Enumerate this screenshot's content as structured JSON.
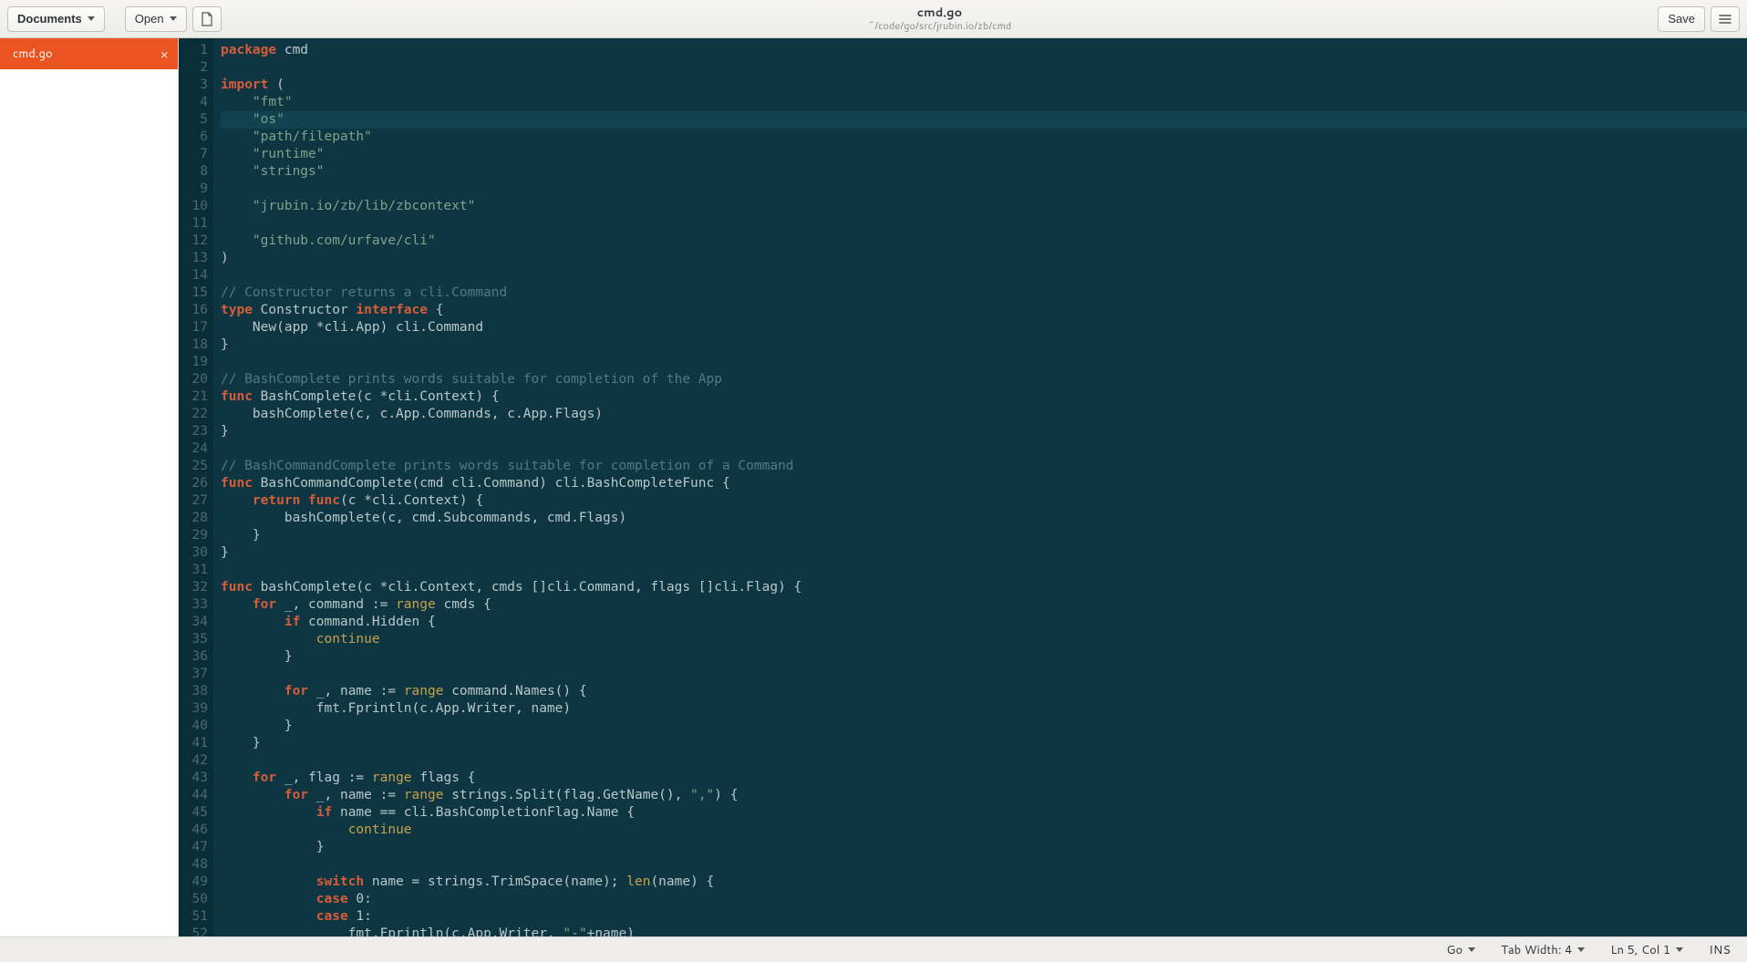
{
  "header": {
    "documents_label": "Documents",
    "open_label": "Open",
    "save_label": "Save",
    "title": "cmd.go",
    "subtitle": "~/code/go/src/jrubin.io/zb/cmd"
  },
  "sidebar": {
    "tabs": [
      {
        "label": "cmd.go",
        "active": true
      }
    ]
  },
  "editor": {
    "current_line_index": 4,
    "lines": [
      [
        [
          "kw",
          "package"
        ],
        [
          "plain",
          " cmd"
        ]
      ],
      [],
      [
        [
          "kw",
          "import"
        ],
        [
          "plain",
          " ("
        ]
      ],
      [
        [
          "plain",
          "    "
        ],
        [
          "str",
          "\"fmt\""
        ]
      ],
      [
        [
          "plain",
          "    "
        ],
        [
          "str",
          "\"os\""
        ]
      ],
      [
        [
          "plain",
          "    "
        ],
        [
          "str",
          "\"path/filepath\""
        ]
      ],
      [
        [
          "plain",
          "    "
        ],
        [
          "str",
          "\"runtime\""
        ]
      ],
      [
        [
          "plain",
          "    "
        ],
        [
          "str",
          "\"strings\""
        ]
      ],
      [],
      [
        [
          "plain",
          "    "
        ],
        [
          "str",
          "\"jrubin.io/zb/lib/zbcontext\""
        ]
      ],
      [],
      [
        [
          "plain",
          "    "
        ],
        [
          "str",
          "\"github.com/urfave/cli\""
        ]
      ],
      [
        [
          "plain",
          ")"
        ]
      ],
      [],
      [
        [
          "comment",
          "// Constructor returns a cli.Command"
        ]
      ],
      [
        [
          "kw",
          "type"
        ],
        [
          "plain",
          " Constructor "
        ],
        [
          "kw",
          "interface"
        ],
        [
          "plain",
          " {"
        ]
      ],
      [
        [
          "plain",
          "    New(app *cli.App) cli.Command"
        ]
      ],
      [
        [
          "plain",
          "}"
        ]
      ],
      [],
      [
        [
          "comment",
          "// BashComplete prints words suitable for completion of the App"
        ]
      ],
      [
        [
          "kw",
          "func"
        ],
        [
          "plain",
          " BashComplete(c *cli.Context) {"
        ]
      ],
      [
        [
          "plain",
          "    bashComplete(c, c.App.Commands, c.App.Flags)"
        ]
      ],
      [
        [
          "plain",
          "}"
        ]
      ],
      [],
      [
        [
          "comment",
          "// BashCommandComplete prints words suitable for completion of a Command"
        ]
      ],
      [
        [
          "kw",
          "func"
        ],
        [
          "plain",
          " BashCommandComplete(cmd cli.Command) cli.BashCompleteFunc {"
        ]
      ],
      [
        [
          "plain",
          "    "
        ],
        [
          "kw",
          "return"
        ],
        [
          "plain",
          " "
        ],
        [
          "kw",
          "func"
        ],
        [
          "plain",
          "(c *cli.Context) {"
        ]
      ],
      [
        [
          "plain",
          "        bashComplete(c, cmd.Subcommands, cmd.Flags)"
        ]
      ],
      [
        [
          "plain",
          "    }"
        ]
      ],
      [
        [
          "plain",
          "}"
        ]
      ],
      [],
      [
        [
          "kw",
          "func"
        ],
        [
          "plain",
          " bashComplete(c *cli.Context, cmds []cli.Command, flags []cli.Flag) {"
        ]
      ],
      [
        [
          "plain",
          "    "
        ],
        [
          "kw",
          "for"
        ],
        [
          "plain",
          " _, command := "
        ],
        [
          "builtin",
          "range"
        ],
        [
          "plain",
          " cmds {"
        ]
      ],
      [
        [
          "plain",
          "        "
        ],
        [
          "kw",
          "if"
        ],
        [
          "plain",
          " command.Hidden {"
        ]
      ],
      [
        [
          "plain",
          "            "
        ],
        [
          "builtin",
          "continue"
        ]
      ],
      [
        [
          "plain",
          "        }"
        ]
      ],
      [],
      [
        [
          "plain",
          "        "
        ],
        [
          "kw",
          "for"
        ],
        [
          "plain",
          " _, name := "
        ],
        [
          "builtin",
          "range"
        ],
        [
          "plain",
          " command.Names() {"
        ]
      ],
      [
        [
          "plain",
          "            fmt.Fprintln(c.App.Writer, name)"
        ]
      ],
      [
        [
          "plain",
          "        }"
        ]
      ],
      [
        [
          "plain",
          "    }"
        ]
      ],
      [],
      [
        [
          "plain",
          "    "
        ],
        [
          "kw",
          "for"
        ],
        [
          "plain",
          " _, flag := "
        ],
        [
          "builtin",
          "range"
        ],
        [
          "plain",
          " flags {"
        ]
      ],
      [
        [
          "plain",
          "        "
        ],
        [
          "kw",
          "for"
        ],
        [
          "plain",
          " _, name := "
        ],
        [
          "builtin",
          "range"
        ],
        [
          "plain",
          " strings.Split(flag.GetName(), "
        ],
        [
          "str",
          "\",\""
        ],
        [
          "plain",
          ") {"
        ]
      ],
      [
        [
          "plain",
          "            "
        ],
        [
          "kw",
          "if"
        ],
        [
          "plain",
          " name == cli.BashCompletionFlag.Name {"
        ]
      ],
      [
        [
          "plain",
          "                "
        ],
        [
          "builtin",
          "continue"
        ]
      ],
      [
        [
          "plain",
          "            }"
        ]
      ],
      [],
      [
        [
          "plain",
          "            "
        ],
        [
          "kw",
          "switch"
        ],
        [
          "plain",
          " name = strings.TrimSpace(name); "
        ],
        [
          "builtin",
          "len"
        ],
        [
          "plain",
          "(name) {"
        ]
      ],
      [
        [
          "plain",
          "            "
        ],
        [
          "kw",
          "case"
        ],
        [
          "plain",
          " "
        ],
        [
          "num",
          "0"
        ],
        [
          "plain",
          ":"
        ]
      ],
      [
        [
          "plain",
          "            "
        ],
        [
          "kw",
          "case"
        ],
        [
          "plain",
          " "
        ],
        [
          "num",
          "1"
        ],
        [
          "plain",
          ":"
        ]
      ],
      [
        [
          "plain",
          "                fmt.Fprintln(c.App.Writer, "
        ],
        [
          "str",
          "\"-\""
        ],
        [
          "plain",
          "+name)"
        ]
      ]
    ]
  },
  "statusbar": {
    "language": "Go",
    "tab_width_label": "Tab Width: 4",
    "position": "Ln 5, Col 1",
    "insert_mode": "INS"
  }
}
